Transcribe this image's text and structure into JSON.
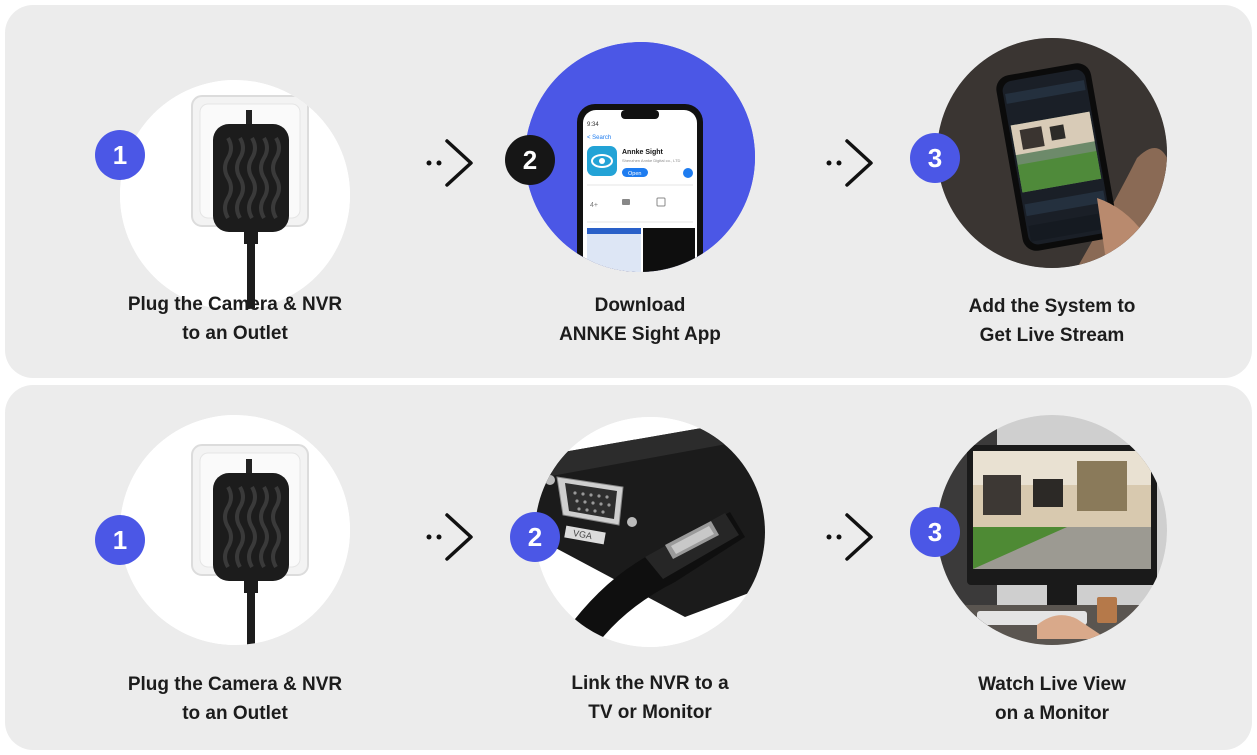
{
  "top_row": {
    "step1": {
      "number": "1",
      "line1": "Plug the Camera & NVR",
      "line2": "to an Outlet",
      "icon": "power-adapter"
    },
    "step2": {
      "number": "2",
      "line1": "Download",
      "line2": "ANNKE Sight App",
      "icon": "app-store-phone",
      "app_name": "Annke Sight",
      "app_publisher": "Shenzhen Annke Digital co., LTD",
      "app_button": "Open",
      "search_label": "< Search",
      "rating": "4+"
    },
    "step3": {
      "number": "3",
      "line1": "Add the System to",
      "line2": "Get Live Stream",
      "icon": "phone-live-stream"
    }
  },
  "bottom_row": {
    "step1": {
      "number": "1",
      "line1": "Plug the Camera & NVR",
      "line2": "to an Outlet",
      "icon": "power-adapter"
    },
    "step2": {
      "number": "2",
      "line1": "Link the NVR to a",
      "line2": "TV or Monitor",
      "icon": "vga-hdmi-ports",
      "port_label": "VGA"
    },
    "step3": {
      "number": "3",
      "line1": "Watch Live View",
      "line2": "on a Monitor",
      "icon": "monitor-live-view"
    }
  },
  "colors": {
    "accent": "#4b57e6",
    "panel": "#ececec",
    "text": "#1c1c1c",
    "badge_dark": "#161616"
  }
}
